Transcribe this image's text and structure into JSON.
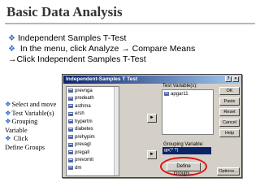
{
  "slide": {
    "title": "Basic Data Analysis",
    "bullets": [
      "Independent Samples T-Test",
      " In the menu, click Analyze → Compare Means",
      "→Click Independent Samples T-Test"
    ],
    "notes": [
      "Select and move",
      "Test Variable(s)",
      "Grouping",
      "Variable",
      " Click",
      "Define Groups"
    ],
    "accent_color": "#3a6fc8"
  },
  "dialog": {
    "title": "Independent-Samples T Test",
    "variables": [
      "prevnga",
      "predeath",
      "asthma",
      "ersh",
      "hypertm",
      "diabetes",
      "prehypim",
      "prevagl",
      "pregall",
      "prevomit",
      "dm"
    ],
    "test_variables_label": "Test Variable(s):",
    "test_variables": [
      "apgar11"
    ],
    "grouping_label": "Grouping Variable:",
    "grouping_value": "gp(? ?)",
    "define_groups_label": "Define Groups...",
    "buttons": {
      "ok": "OK",
      "paste": "Paste",
      "reset": "Reset",
      "cancel": "Cancel",
      "help": "Help",
      "options": "Options..."
    },
    "highlight_color": "#e01010"
  }
}
